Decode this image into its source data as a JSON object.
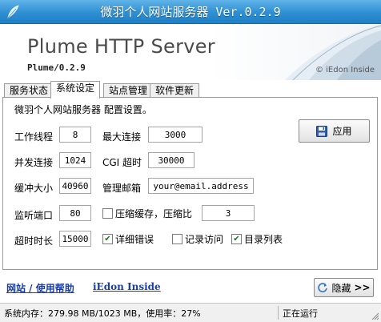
{
  "window": {
    "title": "微羽个人网站服务器 Ver.0.2.9"
  },
  "banner": {
    "product": "Plume HTTP Server",
    "version": "Plume/0.2.9",
    "copyright": "© iEdon Inside"
  },
  "tabs": [
    {
      "label": "服务状态",
      "active": false
    },
    {
      "label": "系统设定",
      "active": true
    },
    {
      "label": "站点管理",
      "active": false
    },
    {
      "label": "软件更新",
      "active": false
    }
  ],
  "settings": {
    "heading": "微羽个人网站服务器 配置设置。",
    "worker_threads": {
      "label": "工作线程",
      "value": "8"
    },
    "max_connections": {
      "label": "最大连接",
      "value": "3000"
    },
    "concurrent": {
      "label": "并发连接",
      "value": "1024"
    },
    "cgi_timeout": {
      "label": "CGI 超时",
      "value": "30000"
    },
    "buffer_size": {
      "label": "缓冲大小",
      "value": "40960"
    },
    "admin_email": {
      "label": "管理邮箱",
      "value": "your@email.address"
    },
    "listen_port": {
      "label": "监听端口",
      "value": "80"
    },
    "compress_cache": {
      "label": "压缩缓存，压缩比",
      "checked": false,
      "value": "3"
    },
    "timeout": {
      "label": "超时时长",
      "value": "15000"
    },
    "detailed_errors": {
      "label": "详细错误",
      "checked": true
    },
    "log_access": {
      "label": "记录访问",
      "checked": false
    },
    "dir_listing": {
      "label": "目录列表",
      "checked": true
    },
    "apply_label": "应用"
  },
  "footer": {
    "link1": "网站 / 使用帮助",
    "link2": "iEdon Inside",
    "hide_label": "隐藏"
  },
  "status": {
    "memory": "系统内存：279.98 MB/1023 MB，使用率：27%",
    "state": "正在运行"
  },
  "colors": {
    "title_bar": "#2f8fd3",
    "link": "#1a3ea8",
    "check_mark": "#1a7a1a"
  }
}
